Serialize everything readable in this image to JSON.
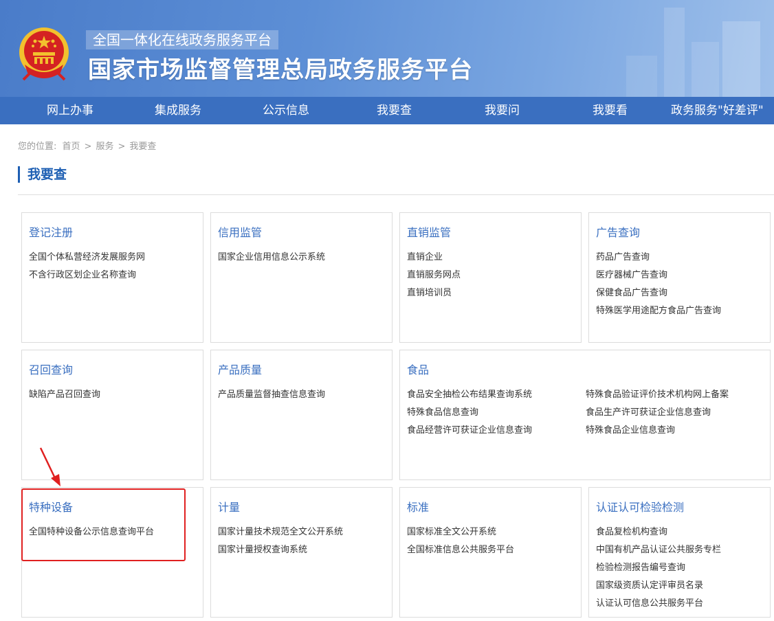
{
  "header": {
    "subtitle": "全国一体化在线政务服务平台",
    "title": "国家市场监督管理总局政务服务平台"
  },
  "nav": [
    "网上办事",
    "集成服务",
    "公示信息",
    "我要查",
    "我要问",
    "我要看",
    "政务服务\"好差评\""
  ],
  "breadcrumb": {
    "label": "您的位置:",
    "items": [
      "首页",
      "服务",
      "我要查"
    ]
  },
  "section_title": "我要查",
  "cards": [
    {
      "title": "登记注册",
      "items": [
        "全国个体私营经济发展服务网",
        "不含行政区划企业名称查询"
      ]
    },
    {
      "title": "信用监管",
      "items": [
        "国家企业信用信息公示系统"
      ]
    },
    {
      "title": "直销监管",
      "items": [
        "直销企业",
        "直销服务网点",
        "直销培训员"
      ]
    },
    {
      "title": "广告查询",
      "items": [
        "药品广告查询",
        "医疗器械广告查询",
        "保健食品广告查询",
        "特殊医学用途配方食品广告查询"
      ]
    },
    {
      "title": "召回查询",
      "items": [
        "缺陷产品召回查询"
      ]
    },
    {
      "title": "产品质量",
      "items": [
        "产品质量监督抽查信息查询"
      ]
    },
    {
      "title": "食品",
      "items": [
        "食品安全抽检公布结果查询系统",
        "特殊食品信息查询",
        "食品经营许可获证企业信息查询"
      ],
      "items2": [
        "特殊食品验证评价技术机构网上备案",
        "食品生产许可获证企业信息查询",
        "特殊食品企业信息查询"
      ]
    },
    {
      "title": "特种设备",
      "items": [
        "全国特种设备公示信息查询平台"
      ]
    },
    {
      "title": "计量",
      "items": [
        "国家计量技术规范全文公开系统",
        "国家计量授权查询系统"
      ]
    },
    {
      "title": "标准",
      "items": [
        "国家标准全文公开系统",
        "全国标准信息公共服务平台"
      ]
    },
    {
      "title": "认证认可检验检测",
      "items": [
        "食品复检机构查询",
        "中国有机产品认证公共服务专栏",
        "检验检测报告编号查询",
        "国家级资质认定评审员名录",
        "认证认可信息公共服务平台"
      ]
    }
  ],
  "colors": {
    "header_blue": "#4a7cc9",
    "nav_blue": "#3a6fc0",
    "title_blue": "#1e5fb3",
    "highlight_red": "#e02020"
  }
}
